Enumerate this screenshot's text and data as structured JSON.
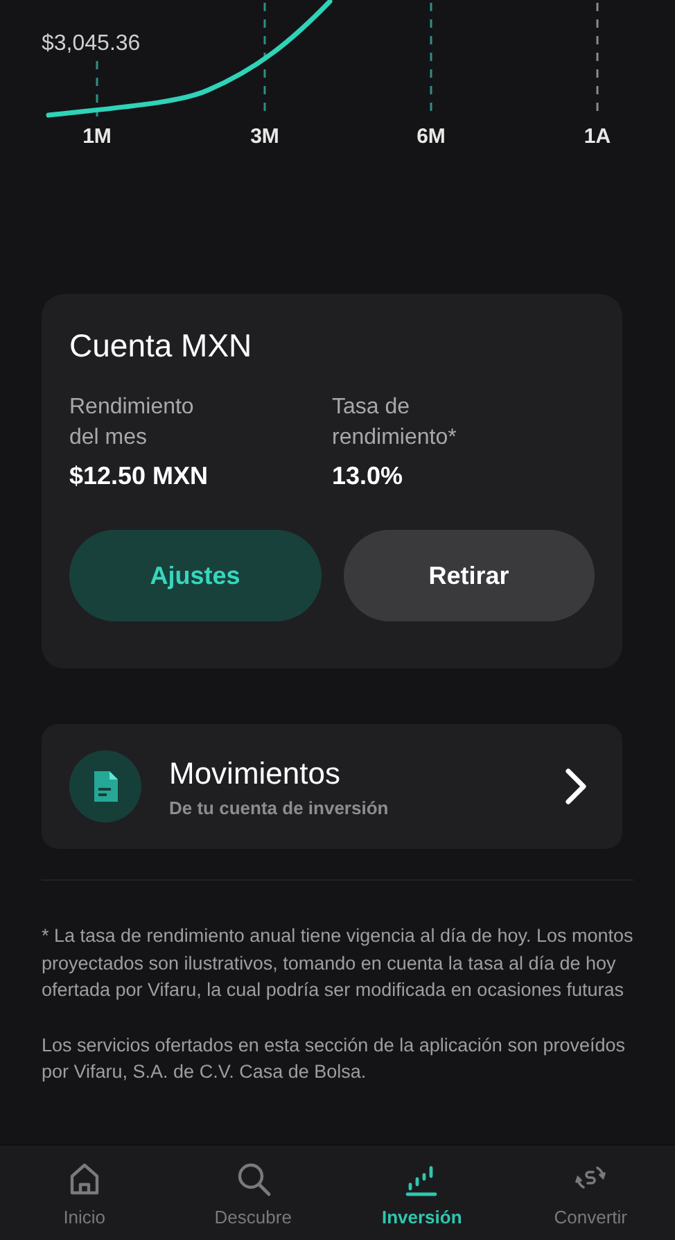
{
  "chart": {
    "value_label": "$3,045.36",
    "x_labels": [
      "1M",
      "3M",
      "6M",
      "1A"
    ]
  },
  "account": {
    "title": "Cuenta MXN",
    "stats": [
      {
        "label": "Rendimiento\ndel mes",
        "value": "$12.50 MXN"
      },
      {
        "label": "Tasa de\nrendimiento*",
        "value": "13.0%"
      }
    ],
    "buttons": [
      {
        "label": "Ajustes",
        "kind": "primary"
      },
      {
        "label": "Retirar",
        "kind": "secondary"
      }
    ]
  },
  "movements": {
    "title": "Movimientos",
    "subtitle": "De tu cuenta de inversión"
  },
  "footnotes": [
    "* La tasa de rendimiento anual tiene vigencia al día de hoy. Los montos proyectados son ilustrativos, tomando en cuenta la tasa al día de hoy ofertada por Vifaru, la cual podría ser modificada en ocasiones futuras",
    "Los servicios ofertados en esta sección de la aplicación son proveídos por Vifaru, S.A. de C.V. Casa de Bolsa."
  ],
  "nav": [
    {
      "label": "Inicio",
      "kind": "home",
      "selected": false
    },
    {
      "label": "Descubre",
      "kind": "search",
      "selected": false
    },
    {
      "label": "Inversión",
      "kind": "invest",
      "selected": true
    },
    {
      "label": "Convertir",
      "kind": "convert",
      "selected": false
    }
  ]
}
